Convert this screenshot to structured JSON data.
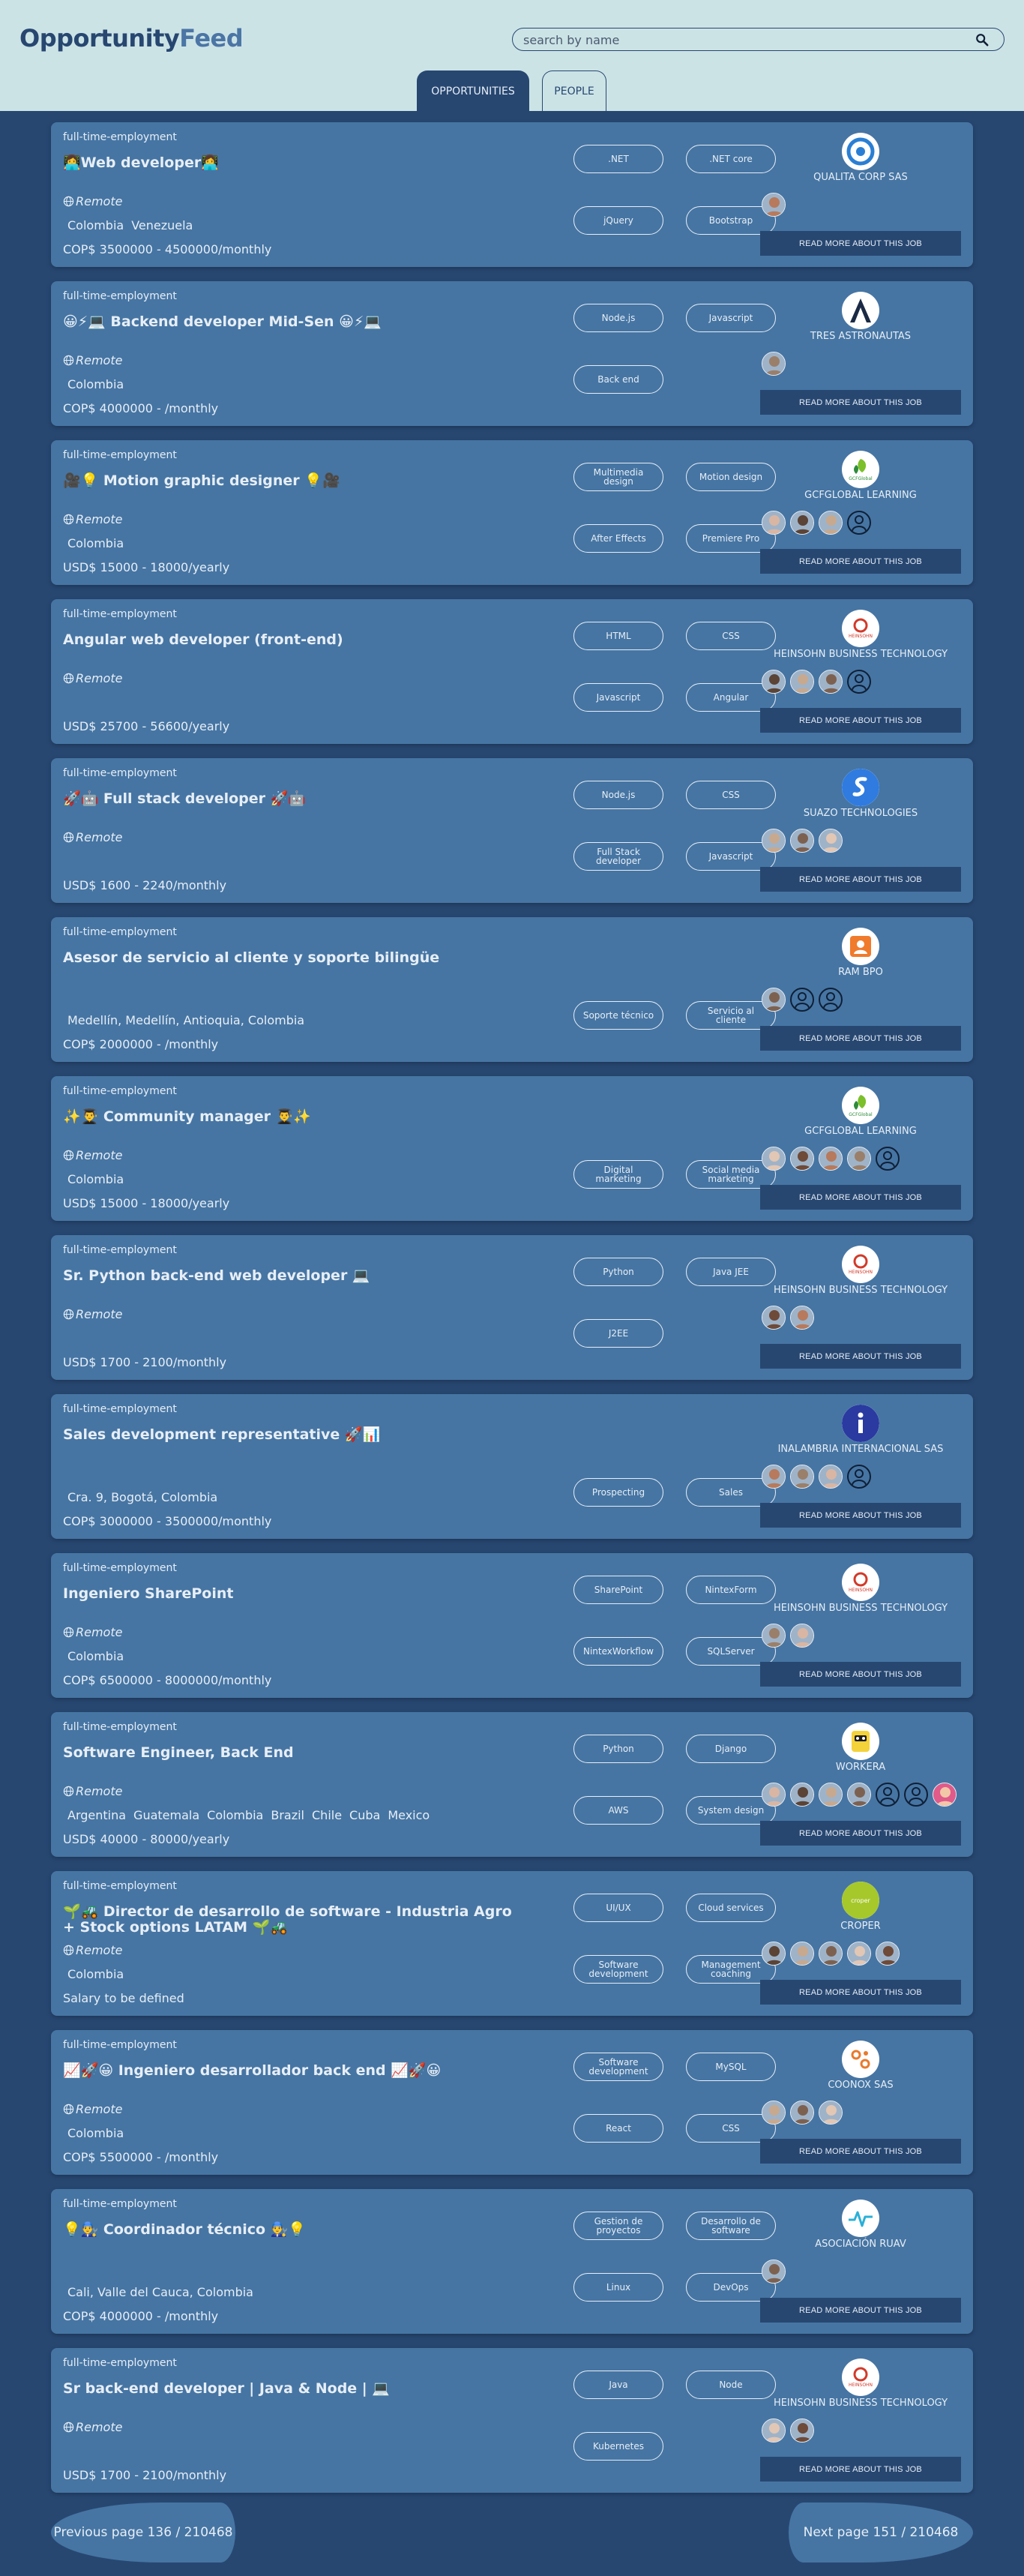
{
  "brand": {
    "part1": "Opportunity",
    "part2": "Feed"
  },
  "search": {
    "placeholder": "search by name"
  },
  "tabs": {
    "opportunities": "OPPORTUNITIES",
    "people": "PEOPLE"
  },
  "read_more_label": "READ MORE ABOUT THIS JOB",
  "jobs": [
    {
      "type": "full-time-employment",
      "title": "👩‍💻Web developer👩‍💻",
      "remote": "Remote",
      "locations": [
        "Colombia",
        "Venezuela"
      ],
      "salary": "COP$ 3500000 - 4500000/monthly",
      "skills": [
        ".NET",
        ".NET core",
        "jQuery",
        "Bootstrap"
      ],
      "company": "QUALITA CORP SAS",
      "logo_icon": "qualita-logo-icon",
      "avatars": 1
    },
    {
      "type": "full-time-employment",
      "title": "😀⚡💻 Backend developer Mid-Sen 😀⚡💻",
      "remote": "Remote",
      "locations": [
        "Colombia"
      ],
      "salary": "COP$ 4000000 - /monthly",
      "skills": [
        "Node.js",
        "Javascript",
        "Back end"
      ],
      "company": "TRES ASTRONAUTAS",
      "logo_icon": "astronautas-logo-icon",
      "avatars": 1
    },
    {
      "type": "full-time-employment",
      "title": "🎥💡 Motion graphic designer 💡🎥",
      "remote": "Remote",
      "locations": [
        "Colombia"
      ],
      "salary": "USD$ 15000 - 18000/yearly",
      "skills": [
        "Multimedia design",
        "Motion design",
        "After Effects",
        "Premiere Pro"
      ],
      "company": "GCFGLOBAL LEARNING",
      "logo_icon": "gcfglobal-logo-icon",
      "avatars": 3,
      "placeholders": 1
    },
    {
      "type": "full-time-employment",
      "title": "Angular web developer (front-end)",
      "remote": "Remote",
      "locations": [],
      "salary": "USD$ 25700 - 56600/yearly",
      "skills": [
        "HTML",
        "CSS",
        "Javascript",
        "Angular"
      ],
      "company": "HEINSOHN BUSINESS TECHNOLOGY",
      "logo_icon": "heinsohn-logo-icon",
      "avatars": 3,
      "placeholders": 1
    },
    {
      "type": "full-time-employment",
      "title": "🚀🤖 Full stack developer 🚀🤖",
      "remote": "Remote",
      "locations": [],
      "salary": "USD$ 1600 - 2240/monthly",
      "skills": [
        "Node.js",
        "CSS",
        "Full Stack developer",
        "Javascript"
      ],
      "company": "SUAZO TECHNOLOGIES",
      "logo_icon": "suazo-logo-icon",
      "avatars": 3
    },
    {
      "type": "full-time-employment",
      "title": "Asesor de servicio al cliente y soporte bilingüe",
      "remote": "",
      "locations": [
        "Medellín, Medellín, Antioquia, Colombia"
      ],
      "salary": "COP$ 2000000 - /monthly",
      "skills": [
        "Soporte técnico",
        "Servicio al cliente"
      ],
      "company": "RAM BPO",
      "logo_icon": "rambpo-logo-icon",
      "avatars": 1,
      "placeholders": 2
    },
    {
      "type": "full-time-employment",
      "title": "✨👨‍🎓 Community manager 👨‍🎓✨",
      "remote": "Remote",
      "locations": [
        "Colombia"
      ],
      "salary": "USD$ 15000 - 18000/yearly",
      "skills": [
        "Digital marketing",
        "Social media marketing"
      ],
      "company": "GCFGLOBAL LEARNING",
      "logo_icon": "gcfglobal-logo-icon",
      "avatars": 4,
      "placeholders": 1
    },
    {
      "type": "full-time-employment",
      "title": "Sr. Python back-end web developer 💻",
      "remote": "Remote",
      "locations": [],
      "salary": "USD$ 1700 - 2100/monthly",
      "skills": [
        "Python",
        "Java JEE",
        "J2EE"
      ],
      "company": "HEINSOHN BUSINESS TECHNOLOGY",
      "logo_icon": "heinsohn-logo-icon",
      "avatars": 2
    },
    {
      "type": "full-time-employment",
      "title": "Sales development representative 🚀📊",
      "remote": "",
      "locations": [
        "Cra. 9, Bogotá, Colombia"
      ],
      "salary": "COP$ 3000000 - 3500000/monthly",
      "skills": [
        "Prospecting",
        "Sales"
      ],
      "company": "INALAMBRIA INTERNACIONAL SAS",
      "logo_icon": "inalambria-logo-icon",
      "avatars": 3,
      "placeholders": 1
    },
    {
      "type": "full-time-employment",
      "title": "Ingeniero SharePoint",
      "remote": "Remote",
      "locations": [
        "Colombia"
      ],
      "salary": "COP$ 6500000 - 8000000/monthly",
      "skills": [
        "SharePoint",
        "NintexForm",
        "NintexWorkflow",
        "SQLServer"
      ],
      "company": "HEINSOHN BUSINESS TECHNOLOGY",
      "logo_icon": "heinsohn-logo-icon",
      "avatars": 2
    },
    {
      "type": "full-time-employment",
      "title": "Software Engineer, Back End",
      "remote": "Remote",
      "locations": [
        "Argentina",
        "Guatemala",
        "Colombia",
        "Brazil",
        "Chile",
        "Cuba",
        "Mexico"
      ],
      "salary": "USD$ 40000 - 80000/yearly",
      "skills": [
        "Python",
        "Django",
        "AWS",
        "System design"
      ],
      "company": "WORKERA",
      "logo_icon": "workera-logo-icon",
      "avatars": 4,
      "placeholders": 2,
      "extra_avatars": 1
    },
    {
      "type": "full-time-employment",
      "title": "🌱🚜 Director de desarrollo de software - Industria Agro + Stock options LATAM 🌱🚜",
      "remote": "Remote",
      "locations": [
        "Colombia"
      ],
      "salary": "Salary to be defined",
      "skills": [
        "UI/UX",
        "Cloud services",
        "Software development",
        "Management coaching"
      ],
      "company": "CROPER",
      "logo_icon": "croper-logo-icon",
      "avatars": 5
    },
    {
      "type": "full-time-employment",
      "title": "📈🚀😀 Ingeniero desarrollador back end 📈🚀😀",
      "remote": "Remote",
      "locations": [
        "Colombia"
      ],
      "salary": "COP$ 5500000 - /monthly",
      "skills": [
        "Software development",
        "MySQL",
        "React",
        "CSS"
      ],
      "company": "COONOX SAS",
      "logo_icon": "coonox-logo-icon",
      "avatars": 3
    },
    {
      "type": "full-time-employment",
      "title": "💡👨‍🔧 Coordinador técnico 👨‍🔧💡",
      "remote": "",
      "locations": [
        "Cali, Valle del Cauca, Colombia"
      ],
      "salary": "COP$ 4000000 - /monthly",
      "skills": [
        "Gestion de proyectos",
        "Desarrollo de software",
        "Linux",
        "DevOps"
      ],
      "company": "ASOCIACIÓN RUAV",
      "logo_icon": "ruav-logo-icon",
      "avatars": 1
    },
    {
      "type": "full-time-employment",
      "title": "Sr back-end developer | Java & Node | 💻",
      "remote": "Remote",
      "locations": [],
      "salary": "USD$ 1700 - 2100/monthly",
      "skills": [
        "Java",
        "Node",
        "Kubernetes"
      ],
      "company": "HEINSOHN BUSINESS TECHNOLOGY",
      "logo_icon": "heinsohn-logo-icon",
      "avatars": 2
    }
  ],
  "pagination": {
    "prev": "Previous page 136 / 210468",
    "next": "Next page 151 / 210468"
  },
  "colors": {
    "header_bg": "#cce3e6",
    "page_bg": "#274771",
    "card_bg": "#4675a3",
    "text": "#e7eef6"
  }
}
